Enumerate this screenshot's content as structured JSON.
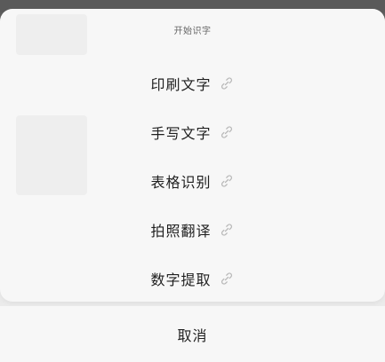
{
  "sheet": {
    "title": "开始识字",
    "items": [
      {
        "label": "印刷文字",
        "icon": "link-icon"
      },
      {
        "label": "手写文字",
        "icon": "link-icon"
      },
      {
        "label": "表格识别",
        "icon": "link-icon"
      },
      {
        "label": "拍照翻译",
        "icon": "link-icon"
      },
      {
        "label": "数字提取",
        "icon": "link-icon"
      }
    ],
    "cancel_label": "取消"
  },
  "colors": {
    "overlay": "#5e5e5e",
    "sheet_bg": "#f7f7f7",
    "separator": "#ebebeb",
    "text": "#1f1f1f",
    "title_text": "#666666",
    "icon": "#b8b8b8"
  }
}
